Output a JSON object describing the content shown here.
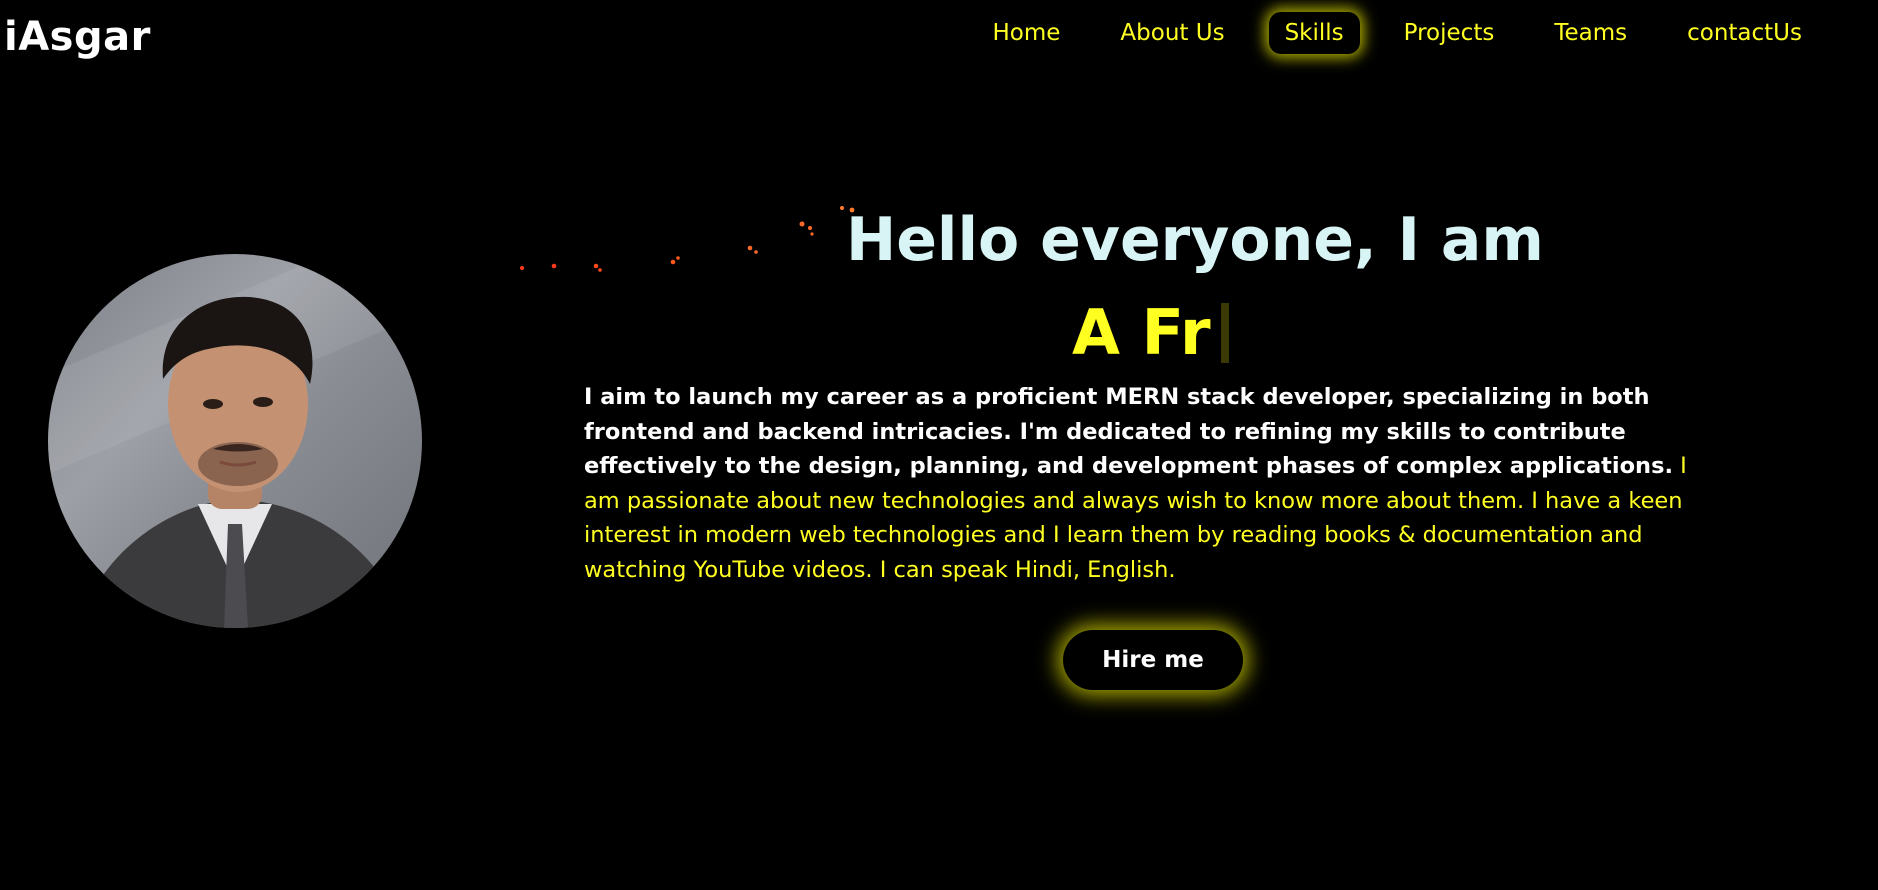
{
  "header": {
    "logo": "iAsgar",
    "nav": [
      {
        "label": "Home"
      },
      {
        "label": "About Us"
      },
      {
        "label": "Skills",
        "active": true
      },
      {
        "label": "Projects"
      },
      {
        "label": "Teams"
      },
      {
        "label": "contactUs"
      }
    ]
  },
  "hero": {
    "greeting": "Hello everyone, I am",
    "typed_text": "A Fr",
    "description_bold": "I aim to launch my career as a proficient MERN stack developer, specializing in both frontend and backend intricacies. I'm dedicated to refining my skills to contribute effectively to the design, planning, and development phases of complex applications.",
    "description_highlight": "I am passionate about new technologies and always wish to know more about them. I have a keen interest in modern web technologies and I learn them by reading books & documentation and watching YouTube videos. I can speak Hindi, English.",
    "hire_button": "Hire me"
  },
  "colors": {
    "background": "#000000",
    "accent_yellow": "#ffff22",
    "greeting": "#d8f4f4",
    "glow": "#e6e600"
  },
  "icons": {
    "avatar": "profile-photo",
    "cursor": "typing-cursor"
  }
}
